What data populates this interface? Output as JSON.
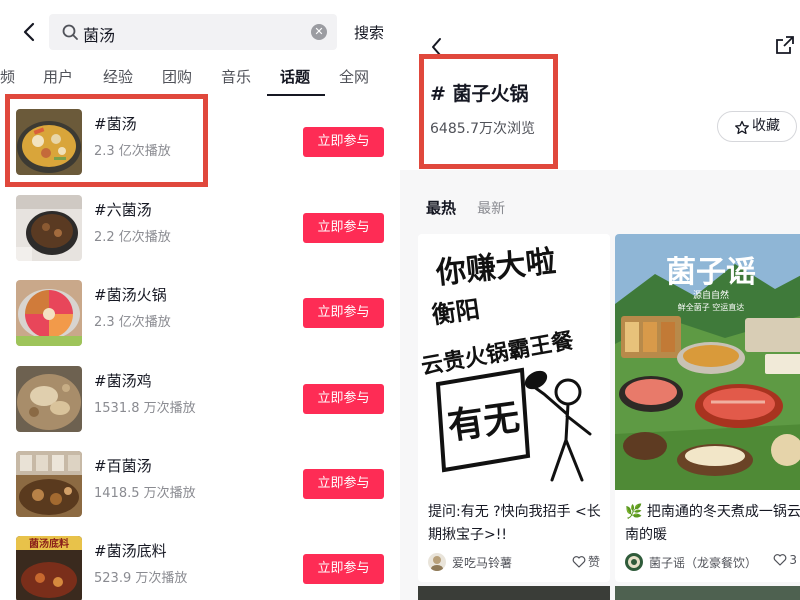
{
  "left": {
    "search": {
      "query": "菌汤",
      "submit_label": "搜索"
    },
    "tabs": [
      "频",
      "用户",
      "经验",
      "团购",
      "音乐",
      "话题",
      "全网"
    ],
    "results": [
      {
        "title": "#菌汤",
        "views": "2.3 亿次播放",
        "button": "立即参与"
      },
      {
        "title": "#六菌汤",
        "views": "2.2 亿次播放",
        "button": "立即参与"
      },
      {
        "title": "#菌汤火锅",
        "views": "2.3 亿次播放",
        "button": "立即参与"
      },
      {
        "title": "#菌汤鸡",
        "views": "1531.8 万次播放",
        "button": "立即参与"
      },
      {
        "title": "#百菌汤",
        "views": "1418.5 万次播放",
        "button": "立即参与"
      },
      {
        "title": "#菌汤底料",
        "views": "523.9 万次播放",
        "button": "立即参与"
      }
    ],
    "thumb6_text": "菌汤底料"
  },
  "right": {
    "topic_title": "# 菌子火锅",
    "topic_views": "6485.7万次浏览",
    "fav_label": "收藏",
    "sort_hot": "最热",
    "sort_new": "最新",
    "cards": [
      {
        "caption": "提问:有无 ?快向我招手 <长期揪宝子>!!",
        "author": "爱吃马铃薯",
        "like": "赞",
        "cover_lines": [
          "你赚大啦",
          "衡阳",
          "云贵火锅霸王餐",
          "有无"
        ]
      },
      {
        "caption": "🌿 把南通的冬天煮成一锅云南的暖",
        "author": "菌子谣（龙豪餐饮）",
        "like": "3",
        "cover_title": "菌子谣",
        "cover_sub1": "源自自然",
        "cover_sub2": "鲜全菌子 空运直达"
      }
    ]
  },
  "colors": {
    "accent": "#fe2c55",
    "highlight": "#e0483c"
  }
}
